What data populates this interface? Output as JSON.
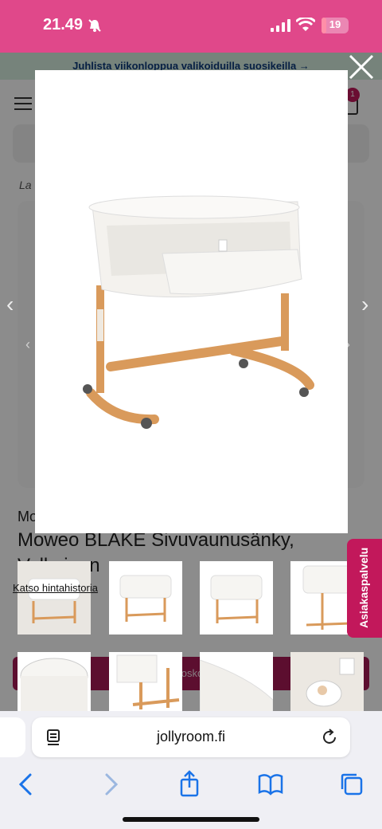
{
  "status_bar": {
    "time": "21.49",
    "battery_level": "19",
    "battery_fraction": 0.19
  },
  "page": {
    "promo_text": "Juhlista viikonloppua valikoiduilla suosikeilla →",
    "cart_count": "1",
    "breadcrumb": "La",
    "brand": "Mo",
    "product_title": "Moweo BLAKE Sivuvaunusänky,",
    "product_subtitle_partial": "Valkoinen",
    "price_history_link": "Katso hintahistoria",
    "buy_button_label": "Ostoskoriin",
    "customer_service_tab": "Asiakaspalvelu"
  },
  "gallery": {
    "image_count": 8,
    "selected_index": 0
  },
  "browser": {
    "url": "jollyroom.fi"
  },
  "colors": {
    "status_bar": "#e0488a",
    "brand_pink": "#c2185b",
    "buy_button": "#a81b57",
    "promo_bg": "#d7eee0",
    "promo_text": "#0b3a7a",
    "wood": "#d99a5b"
  },
  "icons": {
    "close": "close-icon",
    "prev": "chevron-left-icon",
    "next": "chevron-right-icon",
    "share": "share-icon",
    "bookmarks": "book-icon",
    "tabs": "tabs-icon",
    "reload": "reload-icon",
    "reader": "reader-icon"
  }
}
